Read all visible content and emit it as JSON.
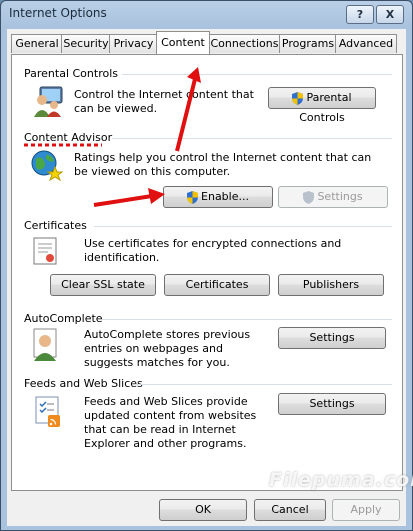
{
  "window": {
    "title": "Internet Options",
    "help_glyph": "?",
    "close_glyph": "X"
  },
  "tabs": [
    {
      "label": "General"
    },
    {
      "label": "Security"
    },
    {
      "label": "Privacy"
    },
    {
      "label": "Content",
      "active": true
    },
    {
      "label": "Connections"
    },
    {
      "label": "Programs"
    },
    {
      "label": "Advanced"
    }
  ],
  "parental": {
    "title": "Parental Controls",
    "text": "Control the Internet content that can be viewed.",
    "button": "Parental Controls"
  },
  "advisor": {
    "title": "Content Advisor",
    "text": "Ratings help you control the Internet content that can be viewed on this computer.",
    "enable_button": "Enable...",
    "settings_button": "Settings"
  },
  "certificates": {
    "title": "Certificates",
    "text": "Use certificates for encrypted connections and identification.",
    "clear_button": "Clear SSL state",
    "certs_button": "Certificates",
    "publishers_button": "Publishers"
  },
  "autocomplete": {
    "title": "AutoComplete",
    "text": "AutoComplete stores previous entries on webpages and suggests matches for you.",
    "settings_button": "Settings"
  },
  "feeds": {
    "title": "Feeds and Web Slices",
    "text": "Feeds and Web Slices provide updated content from websites that can be read in Internet Explorer and other programs.",
    "settings_button": "Settings"
  },
  "footer": {
    "ok": "OK",
    "cancel": "Cancel",
    "apply": "Apply"
  },
  "watermark": "Filepuma.com",
  "colors": {
    "annotation_red": "#e01010",
    "shield_blue": "#2f6fd0",
    "shield_yellow": "#f2c200"
  },
  "icons": [
    "parental-controls-icon",
    "content-advisor-icon",
    "certificate-icon",
    "autocomplete-icon",
    "feeds-icon"
  ]
}
